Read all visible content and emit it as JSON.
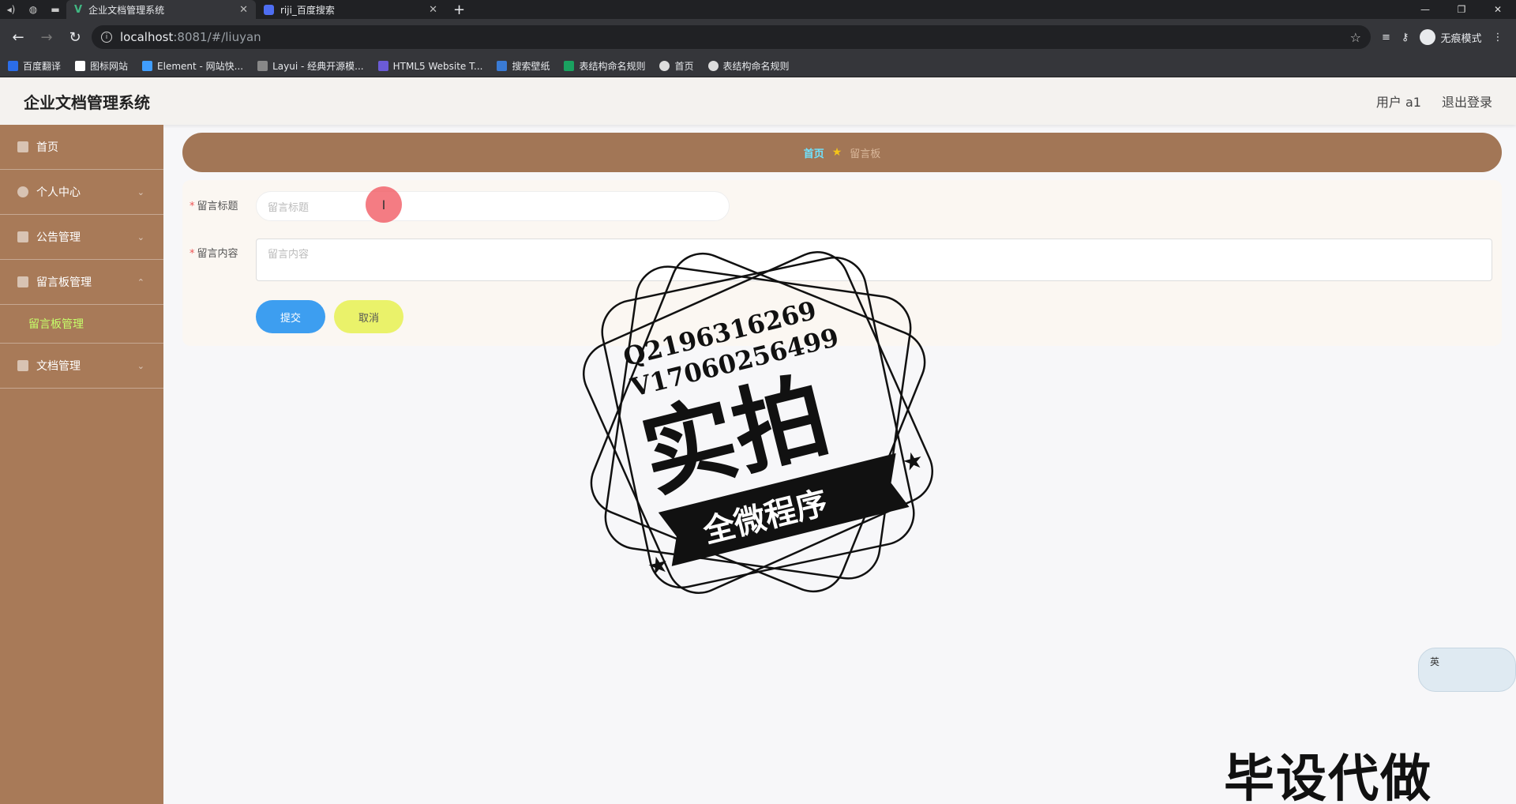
{
  "browser": {
    "tabs": [
      {
        "title": "企业文档管理系统",
        "active": true
      },
      {
        "title": "riji_百度搜索",
        "active": false
      }
    ],
    "url_host": "localhost",
    "url_path": ":8081/#/liuyan",
    "incognito_label": "无痕模式",
    "bookmarks": [
      "百度翻译",
      "图标网站",
      "Element - 网站快...",
      "Layui - 经典开源模...",
      "HTML5 Website T...",
      "搜索壁纸",
      "表结构命名规则",
      "首页",
      "表结构命名规则"
    ]
  },
  "header": {
    "title": "企业文档管理系统",
    "user": "用户 a1",
    "logout": "退出登录"
  },
  "sidebar": {
    "items": [
      {
        "label": "首页"
      },
      {
        "label": "个人中心"
      },
      {
        "label": "公告管理"
      },
      {
        "label": "留言板管理"
      },
      {
        "label": "留言板管理"
      },
      {
        "label": "文档管理"
      }
    ]
  },
  "breadcrumb": {
    "home": "首页",
    "current": "留言板"
  },
  "form": {
    "title_label": "留言标题",
    "title_placeholder": "留言标题",
    "content_label": "留言内容",
    "content_placeholder": "留言内容",
    "submit": "提交",
    "cancel": "取消"
  },
  "overlays": {
    "stamp_line1": "Q2196316269",
    "stamp_line2": "V17060256499",
    "stamp_main": "实拍",
    "stamp_banner": "全微程序",
    "bottom_text": "毕设代做",
    "ime_label": "英"
  },
  "colors": {
    "sidebar": "#a87a58",
    "breadcrumb_bar": "#a27656",
    "submit": "#3d9ef0",
    "cancel": "#eaf26a",
    "active_submenu": "#c6ff6a"
  }
}
